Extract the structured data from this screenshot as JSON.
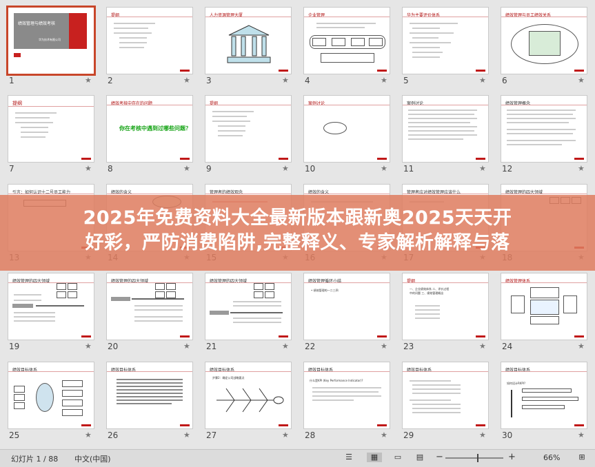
{
  "slides": [
    {
      "n": "1",
      "star": "★",
      "title": "绩效管理与绩效考核",
      "subtitle": "华为技术有限公司",
      "selected": true
    },
    {
      "n": "2",
      "star": "★",
      "title": "提纲"
    },
    {
      "n": "3",
      "star": "★",
      "title": "人力资源管理大厦"
    },
    {
      "n": "4",
      "star": "★",
      "title": "企业管理"
    },
    {
      "n": "5",
      "star": "★",
      "title": "华为主要评价体系"
    },
    {
      "n": "6",
      "star": "★",
      "title": "绩效管理与员工绩效关系"
    },
    {
      "n": "7",
      "star": "★",
      "title": "提纲"
    },
    {
      "n": "8",
      "star": "★",
      "title": "绩效考核中存在的问题",
      "body": "你在考核中遇到过哪些问题？"
    },
    {
      "n": "9",
      "star": "★",
      "title": "提纲"
    },
    {
      "n": "10",
      "star": "★",
      "title": "案例讨论"
    },
    {
      "n": "11",
      "star": "★",
      "title": "案例讨论"
    },
    {
      "n": "12",
      "star": "★",
      "title": "绩效管理概念"
    },
    {
      "n": "13",
      "star": "★",
      "title": "引言：如何认识十二号员工能力"
    },
    {
      "n": "14",
      "star": "★",
      "title": "绩效的含义"
    },
    {
      "n": "15",
      "star": "★",
      "title": "管理者的绩效观念"
    },
    {
      "n": "16",
      "star": "★",
      "title": "绩效的含义"
    },
    {
      "n": "17",
      "star": "★",
      "title": "管理者应对绩效管理应该什么"
    },
    {
      "n": "18",
      "star": "★",
      "title": "绩效管理的四大领域"
    },
    {
      "n": "19",
      "star": "★",
      "title": "绩效管理的四大领域"
    },
    {
      "n": "20",
      "star": "★",
      "title": "绩效管理的四大领域"
    },
    {
      "n": "21",
      "star": "★",
      "title": "绩效管理的四大领域"
    },
    {
      "n": "22",
      "star": "★",
      "title": "绩效管理循环小结",
      "body": "• 绩效管理的一二三四"
    },
    {
      "n": "23",
      "star": "★",
      "title": "提纲",
      "body": "一、企业绩效体系 二、评价过程中的问题 三、绩效管理概念"
    },
    {
      "n": "24",
      "star": "★",
      "title": "绩效管理体系"
    },
    {
      "n": "25",
      "star": "★",
      "title": "绩效目标体系"
    },
    {
      "n": "26",
      "star": "★",
      "title": "绩效目标体系"
    },
    {
      "n": "27",
      "star": "★",
      "title": "绩效目标体系",
      "body": "步骤2：确定公司战略要点"
    },
    {
      "n": "28",
      "star": "★",
      "title": "绩效目标体系",
      "body": "什么是KPI (Key Performance Indicator)?"
    },
    {
      "n": "29",
      "star": "★",
      "title": "绩效目标体系"
    },
    {
      "n": "30",
      "star": "★",
      "title": "绩效目标体系",
      "body": "如何设计RKPI?"
    }
  ],
  "banner": {
    "line1": "2025年免费资料大全最新版本跟新奥2025天天开",
    "line2": "好彩，严防消费陷阱,完整释义、专家解析解释与落"
  },
  "statusbar": {
    "slide_count": "幻灯片 1 / 88",
    "language": "中文(中国)",
    "zoom_minus": "−",
    "zoom_plus": "+",
    "zoom": "66%",
    "zoom_level": 0.66
  },
  "colors": {
    "accent": "#c8462a",
    "brand_red": "#c8211f",
    "banner": "#de7d5f"
  }
}
